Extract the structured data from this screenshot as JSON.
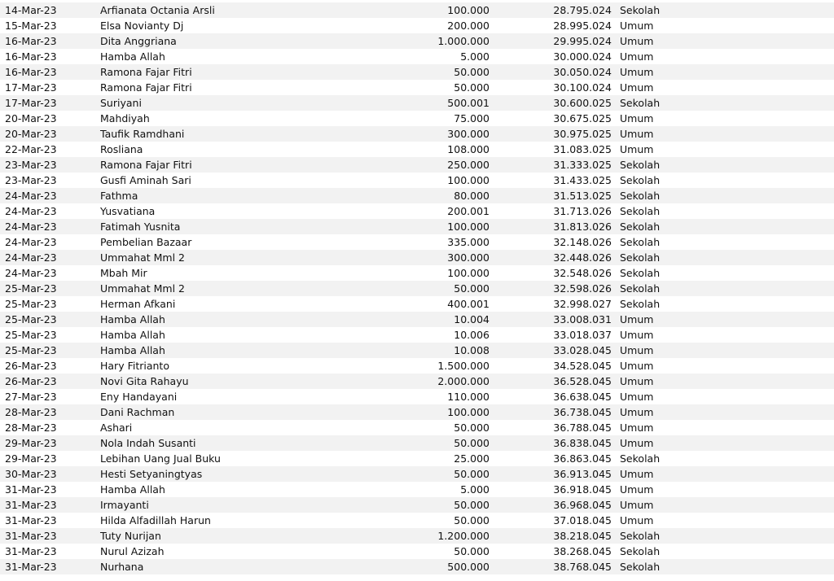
{
  "rows": [
    {
      "date": "14-Mar-23",
      "name": "Arfianata Octania Arsli",
      "amount": "100.000",
      "balance": "28.795.024",
      "category": "Sekolah"
    },
    {
      "date": "15-Mar-23",
      "name": "Elsa Novianty Dj",
      "amount": "200.000",
      "balance": "28.995.024",
      "category": "Umum"
    },
    {
      "date": "16-Mar-23",
      "name": "Dita Anggriana",
      "amount": "1.000.000",
      "balance": "29.995.024",
      "category": "Umum"
    },
    {
      "date": "16-Mar-23",
      "name": "Hamba Allah",
      "amount": "5.000",
      "balance": "30.000.024",
      "category": "Umum"
    },
    {
      "date": "16-Mar-23",
      "name": "Ramona Fajar Fitri",
      "amount": "50.000",
      "balance": "30.050.024",
      "category": "Umum"
    },
    {
      "date": "17-Mar-23",
      "name": "Ramona Fajar Fitri",
      "amount": "50.000",
      "balance": "30.100.024",
      "category": "Umum"
    },
    {
      "date": "17-Mar-23",
      "name": "Suriyani",
      "amount": "500.001",
      "balance": "30.600.025",
      "category": "Sekolah"
    },
    {
      "date": "20-Mar-23",
      "name": "Mahdiyah",
      "amount": "75.000",
      "balance": "30.675.025",
      "category": "Umum"
    },
    {
      "date": "20-Mar-23",
      "name": "Taufik Ramdhani",
      "amount": "300.000",
      "balance": "30.975.025",
      "category": "Umum"
    },
    {
      "date": "22-Mar-23",
      "name": "Rosliana",
      "amount": "108.000",
      "balance": "31.083.025",
      "category": "Umum"
    },
    {
      "date": "23-Mar-23",
      "name": "Ramona Fajar Fitri",
      "amount": "250.000",
      "balance": "31.333.025",
      "category": "Sekolah"
    },
    {
      "date": "23-Mar-23",
      "name": "Gusfi Aminah Sari",
      "amount": "100.000",
      "balance": "31.433.025",
      "category": "Sekolah"
    },
    {
      "date": "24-Mar-23",
      "name": "Fathma",
      "amount": "80.000",
      "balance": "31.513.025",
      "category": "Sekolah"
    },
    {
      "date": "24-Mar-23",
      "name": "Yusvatiana",
      "amount": "200.001",
      "balance": "31.713.026",
      "category": "Sekolah"
    },
    {
      "date": "24-Mar-23",
      "name": "Fatimah Yusnita",
      "amount": "100.000",
      "balance": "31.813.026",
      "category": "Sekolah"
    },
    {
      "date": "24-Mar-23",
      "name": "Pembelian Bazaar",
      "amount": "335.000",
      "balance": "32.148.026",
      "category": "Sekolah"
    },
    {
      "date": "24-Mar-23",
      "name": "Ummahat Mml 2",
      "amount": "300.000",
      "balance": "32.448.026",
      "category": "Sekolah"
    },
    {
      "date": "24-Mar-23",
      "name": "Mbah Mir",
      "amount": "100.000",
      "balance": "32.548.026",
      "category": "Sekolah"
    },
    {
      "date": "25-Mar-23",
      "name": "Ummahat Mml 2",
      "amount": "50.000",
      "balance": "32.598.026",
      "category": "Sekolah"
    },
    {
      "date": "25-Mar-23",
      "name": "Herman Afkani",
      "amount": "400.001",
      "balance": "32.998.027",
      "category": "Sekolah"
    },
    {
      "date": "25-Mar-23",
      "name": "Hamba Allah",
      "amount": "10.004",
      "balance": "33.008.031",
      "category": "Umum"
    },
    {
      "date": "25-Mar-23",
      "name": "Hamba Allah",
      "amount": "10.006",
      "balance": "33.018.037",
      "category": "Umum"
    },
    {
      "date": "25-Mar-23",
      "name": "Hamba Allah",
      "amount": "10.008",
      "balance": "33.028.045",
      "category": "Umum"
    },
    {
      "date": "26-Mar-23",
      "name": "Hary Fitrianto",
      "amount": "1.500.000",
      "balance": "34.528.045",
      "category": "Umum"
    },
    {
      "date": "26-Mar-23",
      "name": "Novi Gita Rahayu",
      "amount": "2.000.000",
      "balance": "36.528.045",
      "category": "Umum"
    },
    {
      "date": "27-Mar-23",
      "name": "Eny Handayani",
      "amount": "110.000",
      "balance": "36.638.045",
      "category": "Umum"
    },
    {
      "date": "28-Mar-23",
      "name": "Dani Rachman",
      "amount": "100.000",
      "balance": "36.738.045",
      "category": "Umum"
    },
    {
      "date": "28-Mar-23",
      "name": "Ashari",
      "amount": "50.000",
      "balance": "36.788.045",
      "category": "Umum"
    },
    {
      "date": "29-Mar-23",
      "name": "Nola Indah Susanti",
      "amount": "50.000",
      "balance": "36.838.045",
      "category": "Umum"
    },
    {
      "date": "29-Mar-23",
      "name": "Lebihan Uang Jual Buku",
      "amount": "25.000",
      "balance": "36.863.045",
      "category": "Sekolah"
    },
    {
      "date": "30-Mar-23",
      "name": "Hesti Setyaningtyas",
      "amount": "50.000",
      "balance": "36.913.045",
      "category": "Umum"
    },
    {
      "date": "31-Mar-23",
      "name": "Hamba Allah",
      "amount": "5.000",
      "balance": "36.918.045",
      "category": "Umum"
    },
    {
      "date": "31-Mar-23",
      "name": "Irmayanti",
      "amount": "50.000",
      "balance": "36.968.045",
      "category": "Umum"
    },
    {
      "date": "31-Mar-23",
      "name": "Hilda Alfadillah Harun",
      "amount": "50.000",
      "balance": "37.018.045",
      "category": "Umum"
    },
    {
      "date": "31-Mar-23",
      "name": "Tuty Nurijan",
      "amount": "1.200.000",
      "balance": "38.218.045",
      "category": "Sekolah"
    },
    {
      "date": "31-Mar-23",
      "name": "Nurul Azizah",
      "amount": "50.000",
      "balance": "38.268.045",
      "category": "Sekolah"
    },
    {
      "date": "31-Mar-23",
      "name": "Nurhana",
      "amount": "500.000",
      "balance": "38.768.045",
      "category": "Sekolah"
    }
  ]
}
